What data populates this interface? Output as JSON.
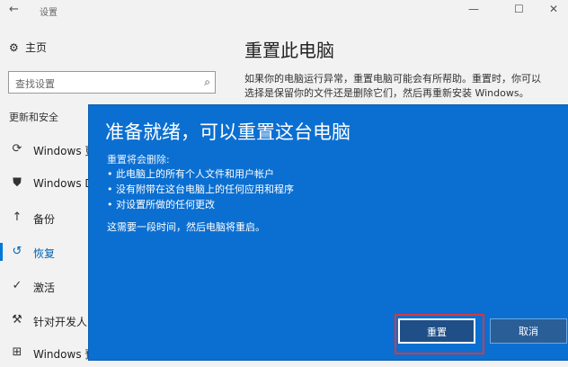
{
  "window": {
    "title": "设置",
    "back_glyph": "←",
    "min_glyph": "—",
    "max_glyph": "☐",
    "close_glyph": "✕"
  },
  "sidebar": {
    "home": {
      "icon": "gear-icon",
      "label": "主页"
    },
    "search": {
      "placeholder": "查找设置"
    },
    "section": "更新和安全",
    "items": [
      {
        "icon": "refresh-icon",
        "label": "Windows 更"
      },
      {
        "icon": "shield-icon",
        "label": "Windows D"
      },
      {
        "icon": "backup-arrow-icon",
        "label": "备份"
      },
      {
        "icon": "history-icon",
        "label": "恢复"
      },
      {
        "icon": "check-circle-icon",
        "label": "激活"
      },
      {
        "icon": "developer-icon",
        "label": "针对开发人"
      },
      {
        "icon": "windows-icon",
        "label": "Windows 预"
      }
    ]
  },
  "main": {
    "title": "重置此电脑",
    "description": "如果你的电脑运行异常，重置电脑可能会有所帮助。重置时，你可以选择是保留你的文件还是删除它们，然后再重新安装 Windows。"
  },
  "dialog": {
    "title": "准备就绪，可以重置这台电脑",
    "subtitle": "重置将会删除:",
    "items": [
      "• 此电脑上的所有个人文件和用户帐户",
      "• 没有附带在这台电脑上的任何应用和程序",
      "• 对设置所做的任何更改"
    ],
    "note": "这需要一段时间，然后电脑将重启。",
    "reset_label": "重置",
    "cancel_label": "取消"
  },
  "colors": {
    "dialog_bg": "#0b6fd1",
    "accent": "#0078d7",
    "highlight": "#d9373b"
  }
}
